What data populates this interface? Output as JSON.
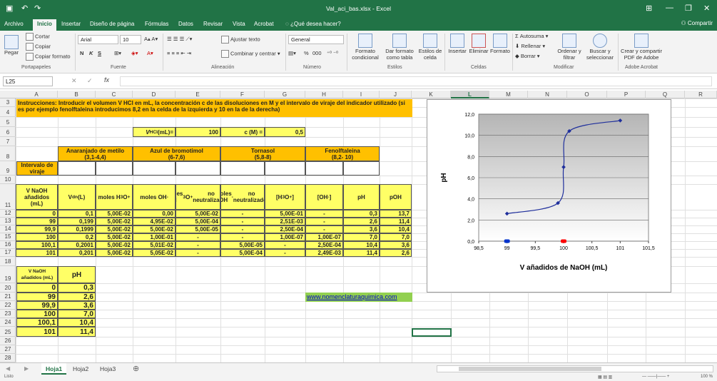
{
  "app": {
    "filename": "Val_aci_bas.xlsx - Excel",
    "share": "Compartir"
  },
  "tabs": [
    "Archivo",
    "Inicio",
    "Insertar",
    "Diseño de página",
    "Fórmulas",
    "Datos",
    "Revisar",
    "Vista",
    "Acrobat",
    "¿Qué desea hacer?"
  ],
  "ribbon": {
    "clipboard": {
      "paste": "Pegar",
      "cut": "Cortar",
      "copy": "Copiar",
      "format_copy": "Copiar formato",
      "label": "Portapapeles"
    },
    "font": {
      "name": "Arial",
      "size": "10",
      "label": "Fuente",
      "bold": "N",
      "italic": "K",
      "underline": "S"
    },
    "align": {
      "wrap": "Ajustar texto",
      "merge": "Combinar y centrar",
      "label": "Alineación"
    },
    "number": {
      "format": "General",
      "percent": "%",
      "thousands": "000",
      "label": "Número"
    },
    "styles": {
      "cond": "Formato condicional",
      "table": "Dar formato como tabla",
      "cell": "Estilos de celda",
      "label": "Estilos"
    },
    "cells": {
      "insert": "Insertar",
      "delete": "Eliminar",
      "format": "Formato",
      "label": "Celdas"
    },
    "edit": {
      "autosum": "Autosuma",
      "fill": "Rellenar",
      "clear": "Borrar",
      "sort": "Ordenar y filtrar",
      "find": "Buscar y seleccionar",
      "label": "Modificar"
    },
    "acrobat": {
      "create": "Crear y compartir PDF de Adobe",
      "label": "Adobe Acrobat"
    }
  },
  "formula_bar": {
    "namebox": "L25",
    "fx": "fx",
    "value": ""
  },
  "columns": [
    "A",
    "B",
    "C",
    "D",
    "E",
    "F",
    "G",
    "H",
    "I",
    "J",
    "K",
    "L",
    "M",
    "N",
    "O",
    "P",
    "Q",
    "R",
    "S"
  ],
  "selected_column": "L",
  "rows": [
    "3",
    "4",
    "5",
    "6",
    "7",
    "8",
    "9",
    "10",
    "11",
    "12",
    "13",
    "14",
    "15",
    "16",
    "17",
    "18",
    "19",
    "20",
    "21",
    "22",
    "23",
    "24",
    "25",
    "26",
    "27",
    "28"
  ],
  "sheet": {
    "instructions": "Instrucciones:  Introducir el volumen V  HCl en mL,  la concentración c  de las disoluciones en M y el intervalo de viraje del indicador utilizado (si es por ejemplo fenolftaleina introducimos 8,2 en la celda de la izquierda y 10 en la de la derecha)",
    "v_label": "V HCl (mL)=",
    "v_value": "100",
    "c_label": "c (M) =",
    "c_value": "0,5",
    "indicators": [
      {
        "name": "Anaranjado de metilo",
        "range": "(3,1-4,4)"
      },
      {
        "name": "Azul de bromotimol",
        "range": "(6-7,6)"
      },
      {
        "name": "Tornasol",
        "range": "(5,8-8)"
      },
      {
        "name": "Fenolftaleina",
        "range": "(8,2- 10)"
      }
    ],
    "viraje_label": "Intervalo de viraje",
    "headers": [
      "V NaOH añadidos (mL)",
      "V dn (L)",
      "moles  H3O+",
      "moles OH-",
      "moles H3O+ no neutralizados",
      "moles OH- no neutralizados",
      "[H3O+]",
      "[OH-]",
      "pH",
      "pOH"
    ],
    "table": [
      [
        "0",
        "0,1",
        "5,00E-02",
        "0,00",
        "5,00E-02",
        "-",
        "5,00E-01",
        "-",
        "0,3",
        "13,7"
      ],
      [
        "99",
        "0,199",
        "5,00E-02",
        "4,95E-02",
        "5,00E-04",
        "-",
        "2,51E-03",
        "-",
        "2,6",
        "11,4"
      ],
      [
        "99,9",
        "0,1999",
        "5,00E-02",
        "5,00E-02",
        "5,00E-05",
        "-",
        "2,50E-04",
        "-",
        "3,6",
        "10,4"
      ],
      [
        "100",
        "0,2",
        "5,00E-02",
        "1,00E-01",
        "-",
        "-",
        "1,00E-07",
        "1,00E-07",
        "7,0",
        "7,0"
      ],
      [
        "100,1",
        "0,2001",
        "5,00E-02",
        "5,01E-02",
        "-",
        "5,00E-05",
        "-",
        "2,50E-04",
        "10,4",
        "3,6"
      ],
      [
        "101",
        "0,201",
        "5,00E-02",
        "5,05E-02",
        "-",
        "5,00E-04",
        "-",
        "2,49E-03",
        "11,4",
        "2,6"
      ]
    ],
    "small_headers": [
      "V NaOH añadidos (mL)",
      "pH"
    ],
    "small_table": [
      [
        "0",
        "0,3"
      ],
      [
        "99",
        "2,6"
      ],
      [
        "99,9",
        "3,6"
      ],
      [
        "100",
        "7,0"
      ],
      [
        "100,1",
        "10,4"
      ],
      [
        "101",
        "11,4"
      ]
    ],
    "link": "www.nomenclaturaquimica.com"
  },
  "chart_data": {
    "type": "scatter",
    "xlabel": "V añadidos de NaOH (mL)",
    "ylabel": "pH",
    "xlim": [
      98.5,
      101.5
    ],
    "ylim": [
      0,
      12
    ],
    "xticks": [
      "98,5",
      "99",
      "99,5",
      "100",
      "100,5",
      "101",
      "101,5"
    ],
    "yticks": [
      "0,0",
      "2,0",
      "4,0",
      "6,0",
      "8,0",
      "10,0",
      "12,0"
    ],
    "points": [
      {
        "x": 99,
        "y": 2.6
      },
      {
        "x": 99.9,
        "y": 3.6
      },
      {
        "x": 100,
        "y": 7.0
      },
      {
        "x": 100.1,
        "y": 10.4
      },
      {
        "x": 101,
        "y": 11.4
      }
    ],
    "markers": [
      {
        "x": 99,
        "color": "#0033cc"
      },
      {
        "x": 100,
        "color": "#ff0000"
      }
    ],
    "line_color": "#1f2f9c"
  },
  "sheets": [
    "Hoja1",
    "Hoja2",
    "Hoja3"
  ],
  "status": {
    "ready": "Listo",
    "zoom": "100 %"
  }
}
